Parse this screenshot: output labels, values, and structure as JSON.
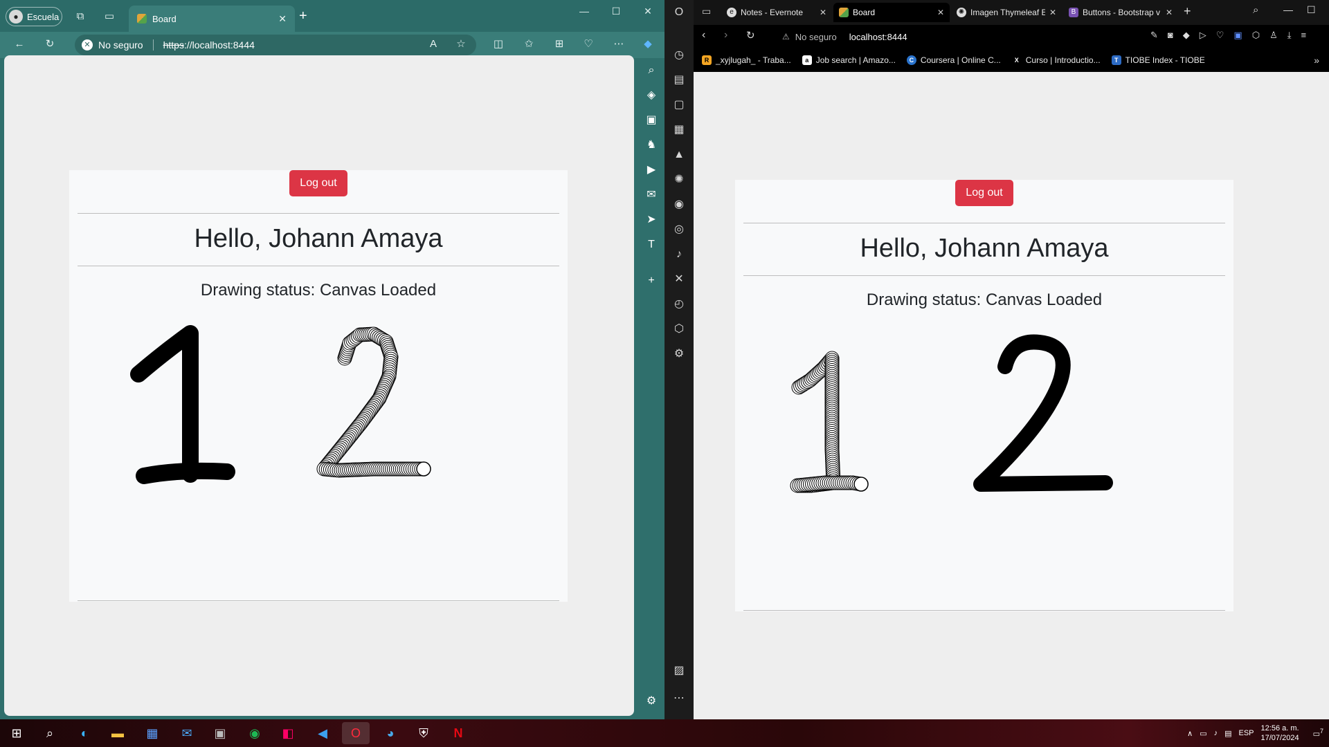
{
  "edge": {
    "profile_label": "Escuela",
    "tab_title": "Board",
    "security_label": "No seguro",
    "url_scheme": "https",
    "url_rest": "://localhost:8444",
    "icons": [
      "workspaces-icon",
      "tab-actions-icon",
      "read-aloud-icon",
      "favorite-icon",
      "split-screen-icon",
      "favorites-icon",
      "collections-icon",
      "performance-icon",
      "more-icon",
      "copilot-icon"
    ],
    "sidebar_icons": [
      "search-icon",
      "shopping-icon",
      "tools-icon",
      "games-icon",
      "bing-icon",
      "outlook-icon",
      "telegram-icon",
      "teams-icon",
      "add-icon",
      "settings-icon"
    ]
  },
  "opera": {
    "tabs": [
      {
        "title": "Notes - Evernote",
        "active": false
      },
      {
        "title": "Board",
        "active": true
      },
      {
        "title": "Imagen Thymeleaf E",
        "active": false
      },
      {
        "title": "Buttons - Bootstrap v",
        "active": false
      }
    ],
    "security_label": "No seguro",
    "url": "localhost:8444",
    "bookmarks": [
      {
        "label": "_xyjlugah_ - Traba...",
        "icon": "R"
      },
      {
        "label": "Job search | Amazo...",
        "icon": "a"
      },
      {
        "label": "Coursera | Online C...",
        "icon": "C"
      },
      {
        "label": "Curso | Introductio...",
        "icon": "X"
      },
      {
        "label": "TIOBE Index - TIOBE",
        "icon": "T"
      }
    ]
  },
  "board": {
    "logout_label": "Log out",
    "greeting": "Hello, Johann Amaya",
    "status": "Drawing status: Canvas Loaded"
  },
  "taskbar": {
    "language": "ESP",
    "time": "12:56 a. m.",
    "date": "17/07/2024",
    "notification_count": "7"
  },
  "colors": {
    "danger": "#dc3545",
    "edge_frame": "#2f6f6c",
    "card_bg": "#f8f9fa"
  }
}
